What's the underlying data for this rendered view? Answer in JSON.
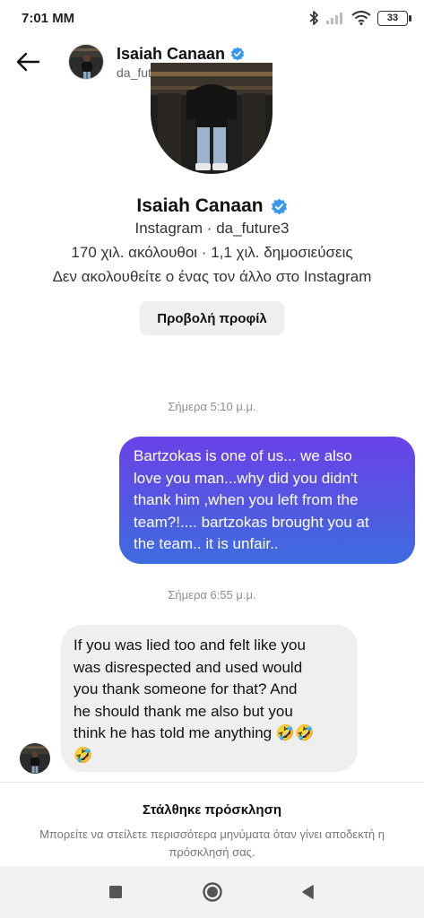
{
  "status_bar": {
    "time": "7:01 MM",
    "battery": "33"
  },
  "header": {
    "name": "Isaiah Canaan",
    "handle": "da_future3"
  },
  "profile": {
    "name": "Isaiah Canaan",
    "source_line": "Instagram · da_future3",
    "stats_line": "170 χιλ. ακόλουθοι · 1,1 χιλ. δημοσιεύσεις",
    "follow_line": "Δεν ακολουθείτε ο ένας τον άλλο στο Instagram",
    "view_profile_label": "Προβολή προφίλ"
  },
  "messages": [
    {
      "timestamp": "Σήμερα 5:10 μ.μ.",
      "direction": "outgoing",
      "lines": [
        "Bartzokas is one of us... we also",
        "love you man...why did you didn't",
        "thank him ,when you left from the",
        "team?!.... bartzokas brought you at",
        "the team.. it is unfair.."
      ]
    },
    {
      "timestamp": "Σήμερα 6:55 μ.μ.",
      "direction": "incoming",
      "lines": [
        "If you was lied too and felt like you",
        "was disrespected and used would",
        "you thank someone for that? And",
        "he should thank me also but you",
        "think he has told me anything 🤣🤣",
        "🤣"
      ]
    }
  ],
  "footer": {
    "title": "Στάλθηκε πρόσκληση",
    "description": "Μπορείτε να στείλετε περισσότερα μηνύματα όταν γίνει αποδεκτή η πρόσκλησή σας."
  },
  "colors": {
    "verified": "#3897f0",
    "outgoing_bubble_top": "#6a42e8",
    "outgoing_bubble_bottom": "#3d6ce0",
    "incoming_bubble": "#efefef"
  },
  "icons": [
    "bluetooth-icon",
    "signal-icon",
    "wifi-icon",
    "battery-icon",
    "back-arrow-icon",
    "verified-badge-icon",
    "stop-square-icon",
    "home-circle-icon",
    "back-triangle-icon"
  ]
}
